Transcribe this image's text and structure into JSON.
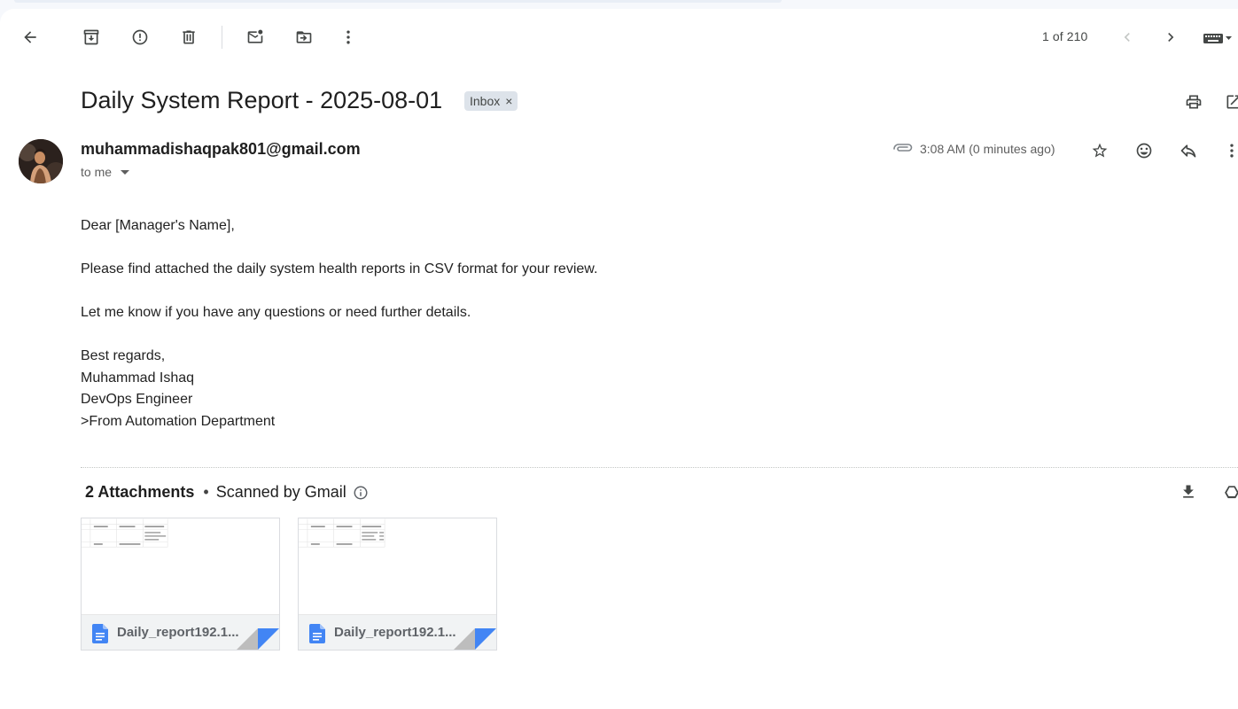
{
  "toolbar": {
    "back": "back-arrow-icon",
    "archive": "archive-icon",
    "spam": "report-spam-icon",
    "delete": "delete-icon",
    "mark_unread": "mark-unread-icon",
    "move": "move-to-icon",
    "more": "more-vert-icon",
    "pager": "1 of 210",
    "prev": "chevron-left-icon",
    "next": "chevron-right-icon",
    "keyboard": "keyboard-icon"
  },
  "email": {
    "subject": "Daily System Report - 2025-08-01",
    "label": "Inbox",
    "label_close": "×",
    "sender": "muhammadishaqpak801@gmail.com",
    "to": "to me",
    "time": "3:08 AM (0 minutes ago)",
    "body": {
      "greeting": "Dear [Manager's Name],",
      "line1": "Please find attached the daily system health reports in CSV format for your review.",
      "line2": "Let me know if you have any questions or need further details.",
      "closing": "Best regards,",
      "name": "Muhammad Ishaq",
      "title": "DevOps Engineer",
      "dept": ">From Automation Department"
    }
  },
  "attachments": {
    "count_label": "2 Attachments",
    "separator": "•",
    "scanned": "Scanned by Gmail",
    "files": [
      {
        "name": "Daily_report192.1..."
      },
      {
        "name": "Daily_report192.1..."
      }
    ]
  },
  "colors": {
    "icon": "#444746",
    "doc_blue": "#4285f4",
    "chip": "#dde3ea"
  }
}
